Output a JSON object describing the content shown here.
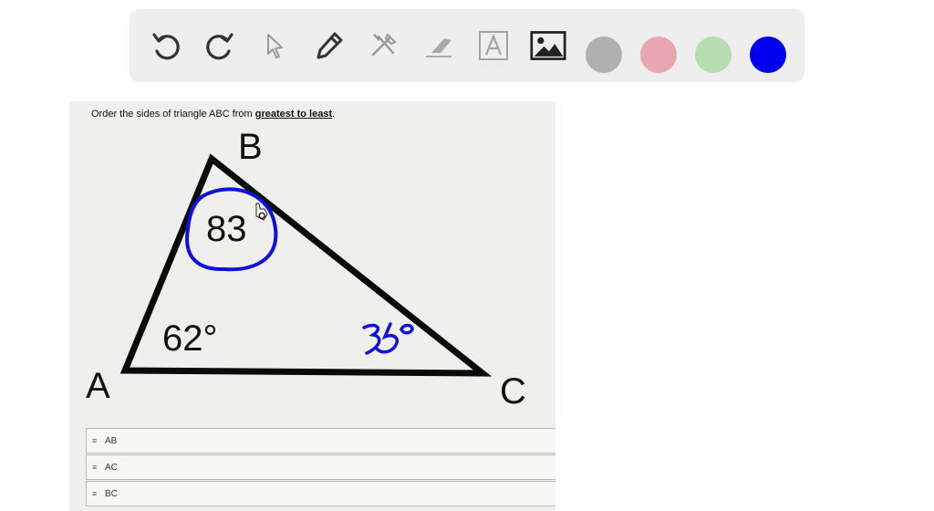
{
  "toolbar": {
    "tools": [
      "undo-icon",
      "redo-icon",
      "pointer-icon",
      "pen-icon",
      "eraser-tools-icon",
      "highlighter-icon",
      "text-icon",
      "image-icon"
    ],
    "colors": [
      "#b0b0b0",
      "#e8a7ae",
      "#b7dcb1",
      "#0000ee"
    ]
  },
  "question": {
    "prefix": "Order the sides of triangle ABC from ",
    "emphasis": "greatest to least",
    "suffix": "."
  },
  "triangle": {
    "vertices": {
      "a": "A",
      "b": "B",
      "c": "C"
    },
    "angle_a": "62°",
    "angle_b": "83",
    "angle_b_degree": "°",
    "angle_c_handwritten": "35°",
    "ink_color": "#1010dd"
  },
  "answers": [
    "AB",
    "AC",
    "BC"
  ]
}
